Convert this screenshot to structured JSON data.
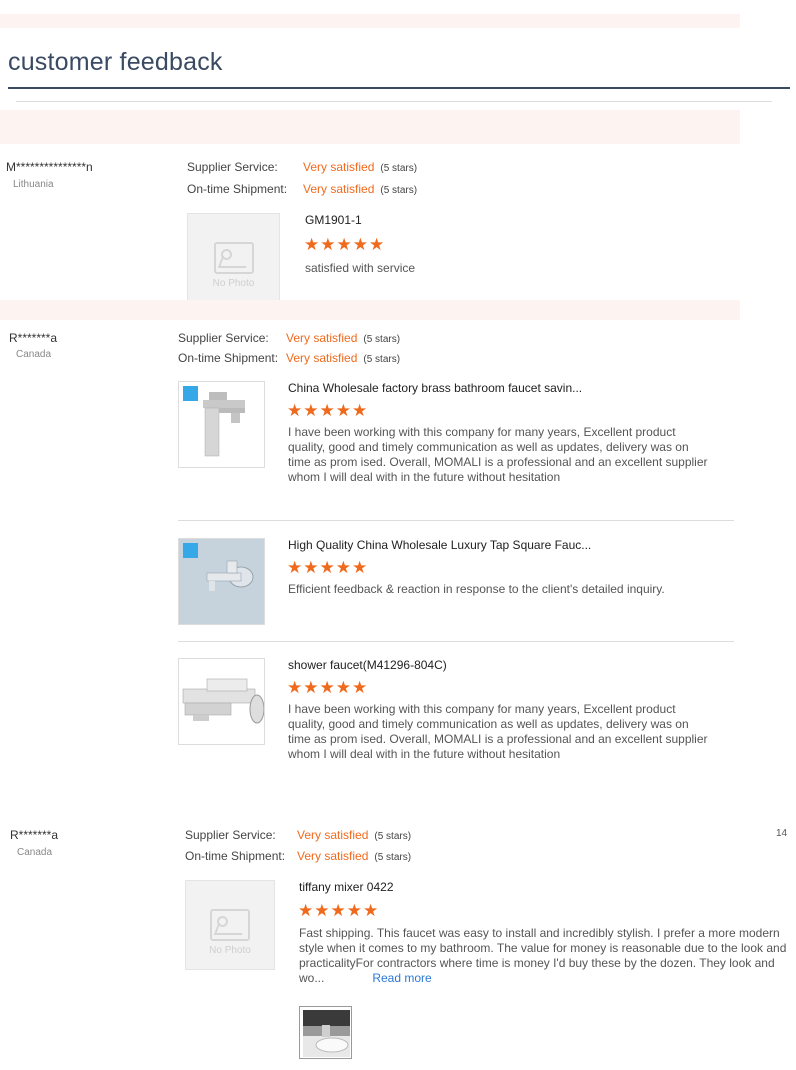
{
  "page": {
    "title": "customer feedback",
    "page_number": "14"
  },
  "reviews": [
    {
      "buyer": "M***************n",
      "country": "Lithuania",
      "supplier_service_label": "Supplier Service:",
      "supplier_service_value": "Very satisfied",
      "supplier_service_stars": "(5 stars)",
      "shipment_label": "On-time Shipment:",
      "shipment_value": "Very satisfied",
      "shipment_stars": "(5 stars)",
      "products": [
        {
          "title": "GM1901-1",
          "rating": 5,
          "stars": "★★★★★",
          "comment": "satisfied with service",
          "image": "No Photo"
        }
      ]
    },
    {
      "buyer": "R*******a",
      "country": "Canada",
      "supplier_service_label": "Supplier Service:",
      "supplier_service_value": "Very satisfied",
      "supplier_service_stars": "(5 stars)",
      "shipment_label": "On-time Shipment:",
      "shipment_value": "Very satisfied",
      "shipment_stars": "(5 stars)",
      "products": [
        {
          "title": "China Wholesale factory brass bathroom faucet savin...",
          "rating": 5,
          "stars": "★★★★★",
          "comment": "I have been working with this company for many years,  Excellent product quality, good and timely communication as well as updates, delivery was on time as prom ised. Overall, MOMALI is a professional and an excellent supplier whom I will deal with in the future without hesitation",
          "image": "faucet-icon"
        },
        {
          "title": "High Quality China Wholesale Luxury Tap Square Fauc...",
          "rating": 5,
          "stars": "★★★★★",
          "comment": "Efficient feedback & reaction in response to the client's detailed inquiry.",
          "image": "wall-tap-icon"
        },
        {
          "title": "shower faucet(M41296-804C)",
          "rating": 5,
          "stars": "★★★★★",
          "comment": "I have been working with this company for many years,  Excellent product quality, good and timely communication as well as updates, delivery was on time as prom ised. Overall, MOMALI is a professional and an excellent supplier whom I will deal with in the future without hesitation",
          "image": "shower-mixer-icon"
        }
      ]
    },
    {
      "buyer": "R*******a",
      "country": "Canada",
      "supplier_service_label": "Supplier Service:",
      "supplier_service_value": "Very satisfied",
      "supplier_service_stars": "(5 stars)",
      "shipment_label": "On-time Shipment:",
      "shipment_value": "Very satisfied",
      "shipment_stars": "(5 stars)",
      "products": [
        {
          "title": "tiffany mixer 0422",
          "rating": 5,
          "stars": "★★★★★",
          "comment": "Fast shipping. This faucet was easy to install and incredibly stylish. I prefer a more modern style when it comes to my bathroom. The value for money is reasonable due to the look and practicalityFor contractors where time is money I'd buy these by the dozen. They look and wo...",
          "read_more": "Read more",
          "image": "No Photo"
        }
      ]
    }
  ],
  "colors": {
    "accent": "#f06a1d",
    "title": "#3a4a63",
    "link": "#2a7ad8",
    "band": "#fdf3f1"
  }
}
